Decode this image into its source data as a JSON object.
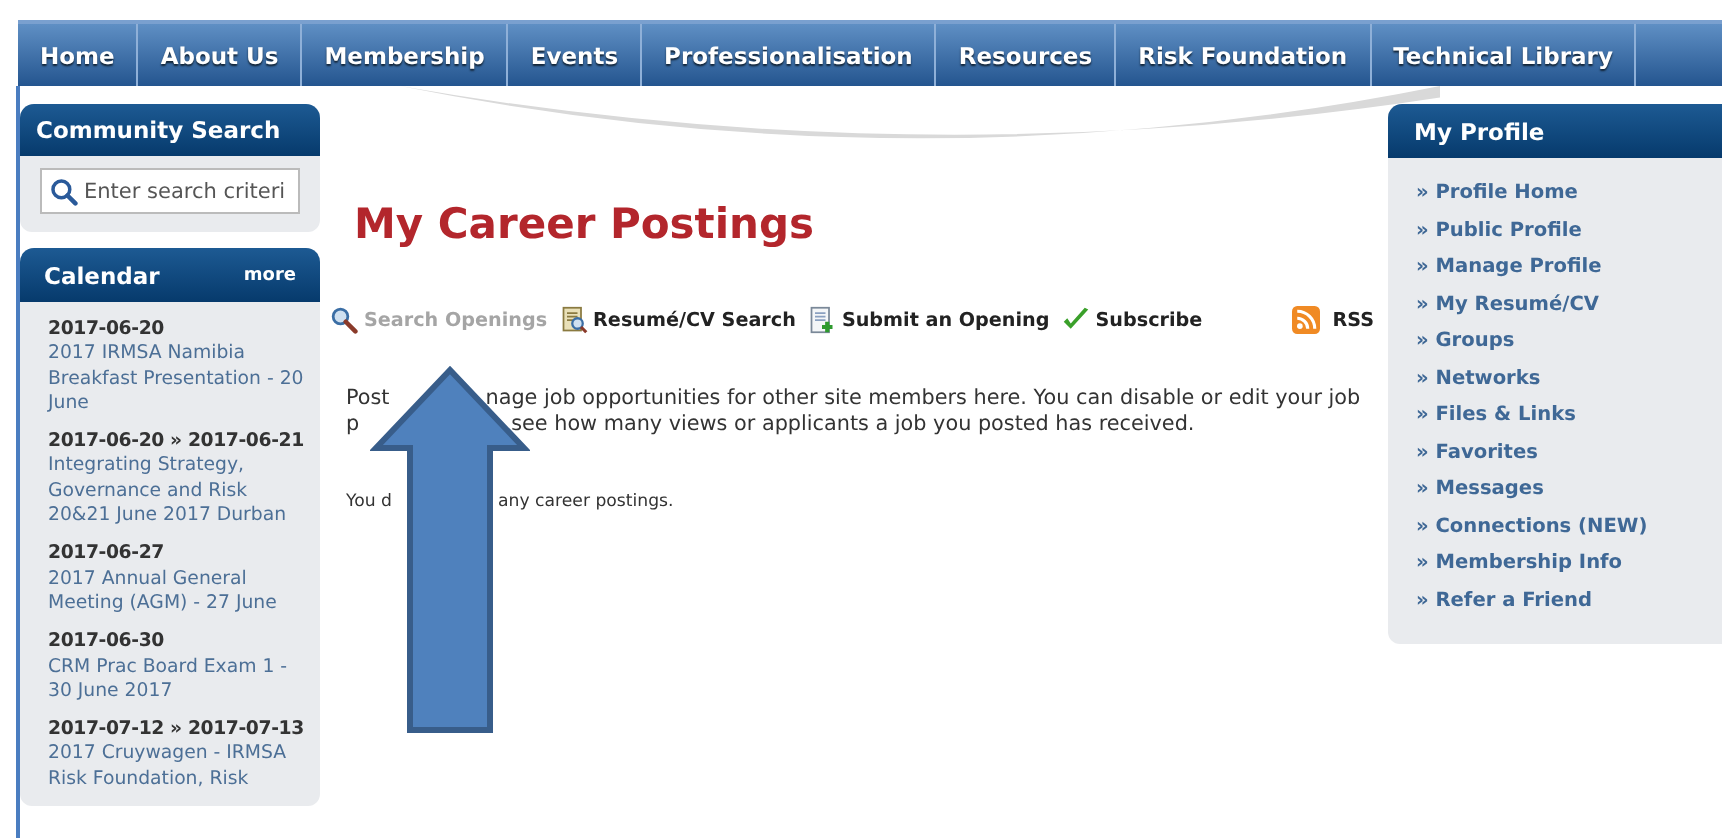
{
  "nav": [
    {
      "label": "Home"
    },
    {
      "label": "About Us"
    },
    {
      "label": "Membership"
    },
    {
      "label": "Events"
    },
    {
      "label": "Professionalisation"
    },
    {
      "label": "Resources"
    },
    {
      "label": "Risk Foundation"
    },
    {
      "label": "Technical Library"
    }
  ],
  "community_search": {
    "title": "Community Search",
    "placeholder": "Enter search criteri"
  },
  "calendar": {
    "title": "Calendar",
    "more": "more",
    "events": [
      {
        "date": "2017-06-20",
        "title": "2017 IRMSA Namibia Breakfast Presentation - 20 June"
      },
      {
        "date": "2017-06-20 » 2017-06-21",
        "title": "Integrating Strategy, Governance and Risk 20&21 June 2017 Durban"
      },
      {
        "date": "2017-06-27",
        "title": "2017 Annual General Meeting (AGM) - 27 June"
      },
      {
        "date": "2017-06-30",
        "title": "CRM Prac Board Exam 1 - 30 June 2017"
      },
      {
        "date": "2017-07-12 » 2017-07-13",
        "title": "2017 Cruywagen - IRMSA Risk Foundation, Risk"
      }
    ]
  },
  "page_title": "My Career Postings",
  "toolbar": [
    {
      "kind": "search",
      "label": "Search Openings",
      "selected": true
    },
    {
      "kind": "resume",
      "label": "Resumé/CV Search",
      "selected": false
    },
    {
      "kind": "submit",
      "label": "Submit an Opening",
      "selected": false
    },
    {
      "kind": "subscribe",
      "label": "Subscribe",
      "selected": false
    }
  ],
  "rss": "RSS",
  "intro_lines": [
    [
      "Post",
      "nage job opportunities for other site members here. You can disable or edit your job"
    ],
    [
      "p",
      "see how many views or applicants a job you posted has received."
    ]
  ],
  "notice": [
    "You d",
    "any career postings."
  ],
  "my_profile": {
    "title": "My Profile",
    "items": [
      "» Profile Home",
      "» Public Profile",
      "» Manage Profile",
      "» My Resumé/CV",
      "» Groups",
      "» Networks",
      "» Files & Links",
      "» Favorites",
      "» Messages",
      "» Connections (NEW)",
      "» Membership Info",
      "» Refer a Friend"
    ]
  }
}
